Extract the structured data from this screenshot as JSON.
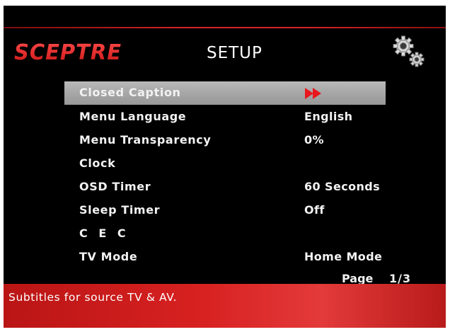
{
  "brand": {
    "logo_text": "SCEPTRE"
  },
  "header": {
    "title": "SETUP",
    "settings_icon": "gears-icon"
  },
  "colors": {
    "brand_red": "#e12a2a",
    "help_bar_red": "#d82121",
    "selection_gray": "#a8a8a8",
    "background": "#000000",
    "text": "#f2f2f2"
  },
  "menu": {
    "items": [
      {
        "label": "Closed Caption",
        "value": "",
        "icon": "submenu-arrow-icon",
        "selected": true
      },
      {
        "label": "Menu Language",
        "value": "English",
        "selected": false
      },
      {
        "label": "Menu Transparency",
        "value": "0%",
        "selected": false
      },
      {
        "label": "Clock",
        "value": "",
        "selected": false
      },
      {
        "label": "OSD Timer",
        "value": "60 Seconds",
        "selected": false
      },
      {
        "label": "Sleep Timer",
        "value": "Off",
        "selected": false
      },
      {
        "label": "C E C",
        "value": "",
        "selected": false
      },
      {
        "label": "TV Mode",
        "value": "Home Mode",
        "selected": false
      }
    ]
  },
  "pagination": {
    "label": "Page",
    "current": 1,
    "total": 3,
    "text": "1/3"
  },
  "help": {
    "text": "Subtitles for source TV & AV."
  }
}
